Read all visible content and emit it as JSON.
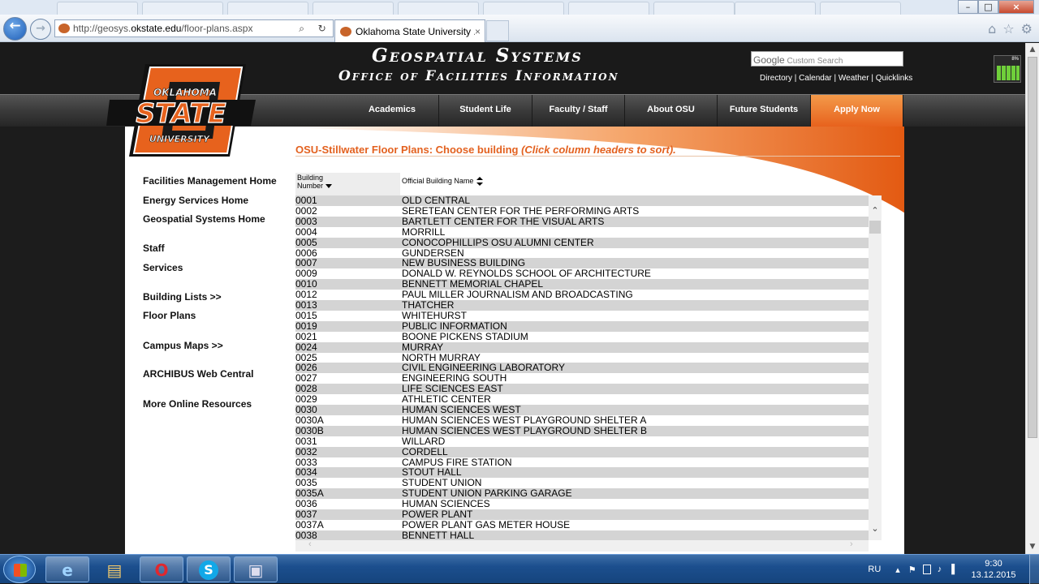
{
  "browser": {
    "address_prefix": "http://geosys.",
    "address_domain": "okstate.edu",
    "address_path": "/floor-plans.aspx",
    "tab_title": "Oklahoma State University ...",
    "back_glyph": "←",
    "forward_glyph": "→",
    "tab_close_glyph": "×",
    "search_glyph": "⌕",
    "refresh_glyph": "↻",
    "home_glyph": "⌂",
    "star_glyph": "☆",
    "gear_glyph": "⚙",
    "minimize_glyph": "–",
    "maximize_glyph": "□",
    "close_glyph": "×"
  },
  "site": {
    "title_line1": "Geospatial Systems",
    "title_line2": "Office of Facilities Information",
    "search_brand": "Google",
    "search_placeholder": "Custom Search",
    "top_links": [
      "Directory",
      "Calendar",
      "Weather",
      "Quicklinks"
    ],
    "signal_label": "8%",
    "logo_top": "OKLAHOMA",
    "logo_mid": "STATE",
    "logo_bottom": "UNIVERSITY",
    "brand_orange": "#e7621d"
  },
  "menu": [
    "Academics",
    "Student Life",
    "Faculty / Staff",
    "About OSU",
    "Future Students",
    "Apply Now"
  ],
  "page": {
    "title_main": "OSU-Stillwater Floor Plans:   Choose building",
    "title_hint": "(Click column headers to sort)."
  },
  "leftnav": [
    "Facilities Management Home",
    "Energy Services Home",
    "Geospatial Systems Home",
    "Staff",
    "Services",
    "Building Lists >>",
    "Floor Plans",
    "Campus Maps >>",
    "ARCHIBUS Web Central",
    "More Online Resources"
  ],
  "table": {
    "col1_line1": "Building",
    "col1_line2": "Number",
    "col2": "Official Building Name",
    "rows": [
      [
        "0001",
        "OLD CENTRAL"
      ],
      [
        "0002",
        "SERETEAN CENTER FOR THE PERFORMING ARTS"
      ],
      [
        "0003",
        "BARTLETT CENTER FOR THE VISUAL ARTS"
      ],
      [
        "0004",
        "MORRILL"
      ],
      [
        "0005",
        "CONOCOPHILLIPS OSU ALUMNI CENTER"
      ],
      [
        "0006",
        "GUNDERSEN"
      ],
      [
        "0007",
        "NEW BUSINESS BUILDING"
      ],
      [
        "0009",
        "DONALD W. REYNOLDS SCHOOL OF ARCHITECTURE"
      ],
      [
        "0010",
        "BENNETT MEMORIAL CHAPEL"
      ],
      [
        "0012",
        "PAUL MILLER JOURNALISM AND BROADCASTING"
      ],
      [
        "0013",
        "THATCHER"
      ],
      [
        "0015",
        "WHITEHURST"
      ],
      [
        "0019",
        "PUBLIC INFORMATION"
      ],
      [
        "0021",
        "BOONE PICKENS STADIUM"
      ],
      [
        "0024",
        "MURRAY"
      ],
      [
        "0025",
        "NORTH MURRAY"
      ],
      [
        "0026",
        "CIVIL ENGINEERING LABORATORY"
      ],
      [
        "0027",
        "ENGINEERING SOUTH"
      ],
      [
        "0028",
        "LIFE SCIENCES EAST"
      ],
      [
        "0029",
        "ATHLETIC CENTER"
      ],
      [
        "0030",
        "HUMAN SCIENCES WEST"
      ],
      [
        "0030A",
        "HUMAN SCIENCES WEST PLAYGROUND SHELTER A"
      ],
      [
        "0030B",
        "HUMAN SCIENCES WEST PLAYGROUND SHELTER B"
      ],
      [
        "0031",
        "WILLARD"
      ],
      [
        "0032",
        "CORDELL"
      ],
      [
        "0033",
        "CAMPUS FIRE STATION"
      ],
      [
        "0034",
        "STOUT HALL"
      ],
      [
        "0035",
        "STUDENT UNION"
      ],
      [
        "0035A",
        "STUDENT UNION PARKING GARAGE"
      ],
      [
        "0036",
        "HUMAN SCIENCES"
      ],
      [
        "0037",
        "POWER PLANT"
      ],
      [
        "0037A",
        "POWER PLANT GAS METER HOUSE"
      ],
      [
        "0038",
        "BENNETT HALL"
      ]
    ],
    "scroll_up_glyph": "⌃",
    "scroll_down_glyph": "⌄",
    "scroll_left_glyph": "‹",
    "scroll_right_glyph": "›"
  },
  "taskbar": {
    "language": "RU",
    "time": "9:30",
    "date": "13.12.2015",
    "tray_up_glyph": "▴",
    "flag_glyph": "⚑",
    "volume_glyph": "♪",
    "signal_glyph": "▐"
  }
}
